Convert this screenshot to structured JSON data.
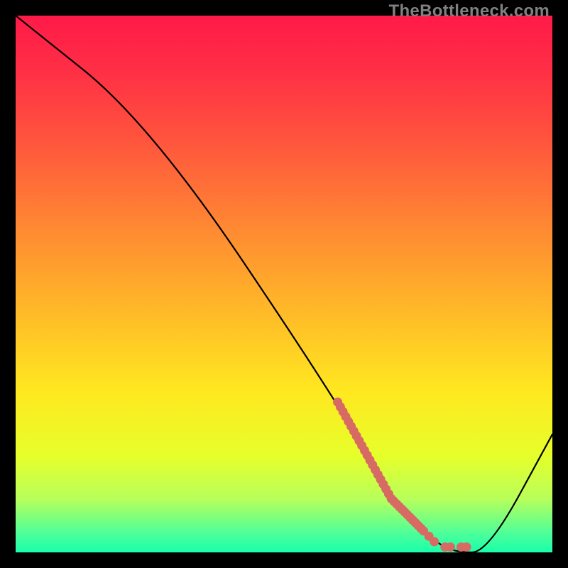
{
  "watermark": "TheBottleneck.com",
  "gradient": {
    "stops": [
      {
        "offset": 0.0,
        "color": "#ff1a48"
      },
      {
        "offset": 0.1,
        "color": "#ff2e45"
      },
      {
        "offset": 0.25,
        "color": "#ff5a3c"
      },
      {
        "offset": 0.4,
        "color": "#ff8a32"
      },
      {
        "offset": 0.55,
        "color": "#ffb928"
      },
      {
        "offset": 0.7,
        "color": "#ffe820"
      },
      {
        "offset": 0.82,
        "color": "#e6ff2a"
      },
      {
        "offset": 0.9,
        "color": "#b8ff5a"
      },
      {
        "offset": 0.965,
        "color": "#4dff9a"
      },
      {
        "offset": 1.0,
        "color": "#19ffaa"
      }
    ]
  },
  "chart_data": {
    "type": "line",
    "title": "",
    "xlabel": "",
    "ylabel": "",
    "xlim": [
      0,
      100
    ],
    "ylim": [
      0,
      100
    ],
    "series": [
      {
        "name": "bottleneck-curve",
        "x": [
          0,
          25,
          60,
          70,
          78,
          82,
          88,
          100
        ],
        "values": [
          100,
          80,
          28,
          10,
          2,
          0,
          0,
          22
        ]
      }
    ],
    "markers": {
      "name": "highlight-dots",
      "color": "#d86a64",
      "points": [
        {
          "x": 60.0,
          "y": 28.0
        },
        {
          "x": 60.5,
          "y": 27.1
        },
        {
          "x": 61.0,
          "y": 26.2
        },
        {
          "x": 61.5,
          "y": 25.3
        },
        {
          "x": 62.0,
          "y": 24.4
        },
        {
          "x": 62.5,
          "y": 23.5
        },
        {
          "x": 63.0,
          "y": 22.6
        },
        {
          "x": 63.5,
          "y": 21.7
        },
        {
          "x": 64.0,
          "y": 20.8
        },
        {
          "x": 64.5,
          "y": 19.9
        },
        {
          "x": 65.0,
          "y": 19.0
        },
        {
          "x": 65.5,
          "y": 18.1
        },
        {
          "x": 66.0,
          "y": 17.2
        },
        {
          "x": 66.5,
          "y": 16.3
        },
        {
          "x": 67.0,
          "y": 15.4
        },
        {
          "x": 67.5,
          "y": 14.5
        },
        {
          "x": 68.0,
          "y": 13.6
        },
        {
          "x": 68.5,
          "y": 12.7
        },
        {
          "x": 69.0,
          "y": 11.8
        },
        {
          "x": 69.5,
          "y": 10.9
        },
        {
          "x": 70.0,
          "y": 10.0
        },
        {
          "x": 70.5,
          "y": 9.5
        },
        {
          "x": 71.0,
          "y": 9.0
        },
        {
          "x": 71.5,
          "y": 8.5
        },
        {
          "x": 72.0,
          "y": 8.0
        },
        {
          "x": 72.5,
          "y": 7.5
        },
        {
          "x": 73.0,
          "y": 7.0
        },
        {
          "x": 73.5,
          "y": 6.5
        },
        {
          "x": 74.0,
          "y": 6.0
        },
        {
          "x": 74.5,
          "y": 5.5
        },
        {
          "x": 75.0,
          "y": 5.0
        },
        {
          "x": 75.5,
          "y": 4.5
        },
        {
          "x": 76.0,
          "y": 4.0
        },
        {
          "x": 77.0,
          "y": 3.0
        },
        {
          "x": 78.0,
          "y": 2.0
        },
        {
          "x": 80.0,
          "y": 1.0
        },
        {
          "x": 81.0,
          "y": 1.0
        },
        {
          "x": 83.0,
          "y": 1.0
        },
        {
          "x": 84.0,
          "y": 1.0
        }
      ]
    }
  }
}
